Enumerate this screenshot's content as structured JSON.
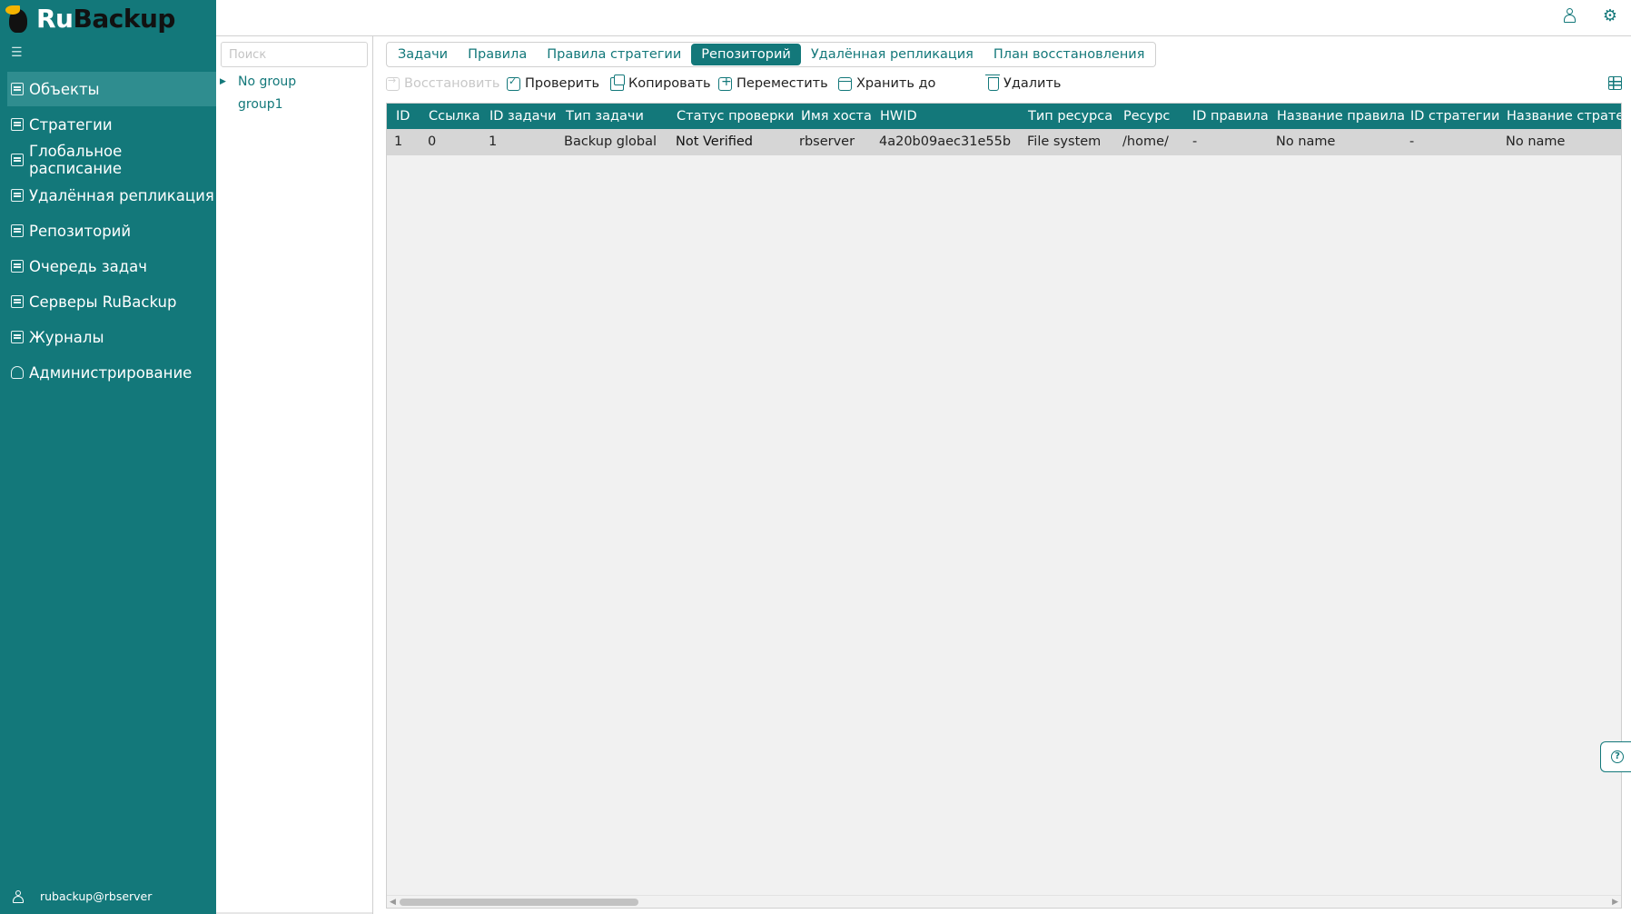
{
  "app": {
    "logo_ru": "Ru",
    "logo_backup": "Backup"
  },
  "sidebar": {
    "items": [
      {
        "label": "Объекты",
        "icon": "monitor-icon",
        "active": true
      },
      {
        "label": "Стратегии",
        "icon": "document-icon"
      },
      {
        "label": "Глобальное расписание",
        "icon": "document-icon"
      },
      {
        "label": "Удалённая репликация",
        "icon": "replication-icon"
      },
      {
        "label": "Репозиторий",
        "icon": "repository-icon"
      },
      {
        "label": "Очередь задач",
        "icon": "clipboard-icon"
      },
      {
        "label": "Серверы RuBackup",
        "icon": "server-icon"
      },
      {
        "label": "Журналы",
        "icon": "log-icon"
      },
      {
        "label": "Администрирование",
        "icon": "admin-icon"
      }
    ],
    "user": "rubackup@rbserver"
  },
  "tree": {
    "search_placeholder": "Поиск",
    "nodes": [
      {
        "label": "No group",
        "expandable": true
      },
      {
        "label": "group1",
        "expandable": false
      }
    ]
  },
  "tabs": [
    {
      "label": "Задачи"
    },
    {
      "label": "Правила"
    },
    {
      "label": "Правила стратегии"
    },
    {
      "label": "Репозиторий",
      "active": true
    },
    {
      "label": "Удалённая репликация"
    },
    {
      "label": "План восстановления"
    }
  ],
  "toolbar": {
    "restore": "Восстановить",
    "verify": "Проверить",
    "copy": "Копировать",
    "move": "Переместить",
    "keep_until": "Хранить до",
    "delete": "Удалить"
  },
  "table": {
    "columns": [
      "ID",
      "Ссылка",
      "ID задачи",
      "Тип задачи",
      "Статус проверки",
      "Имя хоста",
      "HWID",
      "Тип ресурса",
      "Ресурс",
      "ID правила",
      "Название правила",
      "ID стратегии",
      "Название стратегии"
    ],
    "rows": [
      [
        "1",
        "0",
        "1",
        "Backup global",
        "Not Verified",
        "rbserver",
        "4a20b09aec31e55b",
        "File system",
        "/home/",
        "-",
        "No name",
        "-",
        "No name"
      ]
    ]
  },
  "colors": {
    "accent": "#13787a",
    "sidebar_bg": "#13787a",
    "active_item": "#2f8d8f",
    "row_bg": "#d6d6d6"
  }
}
